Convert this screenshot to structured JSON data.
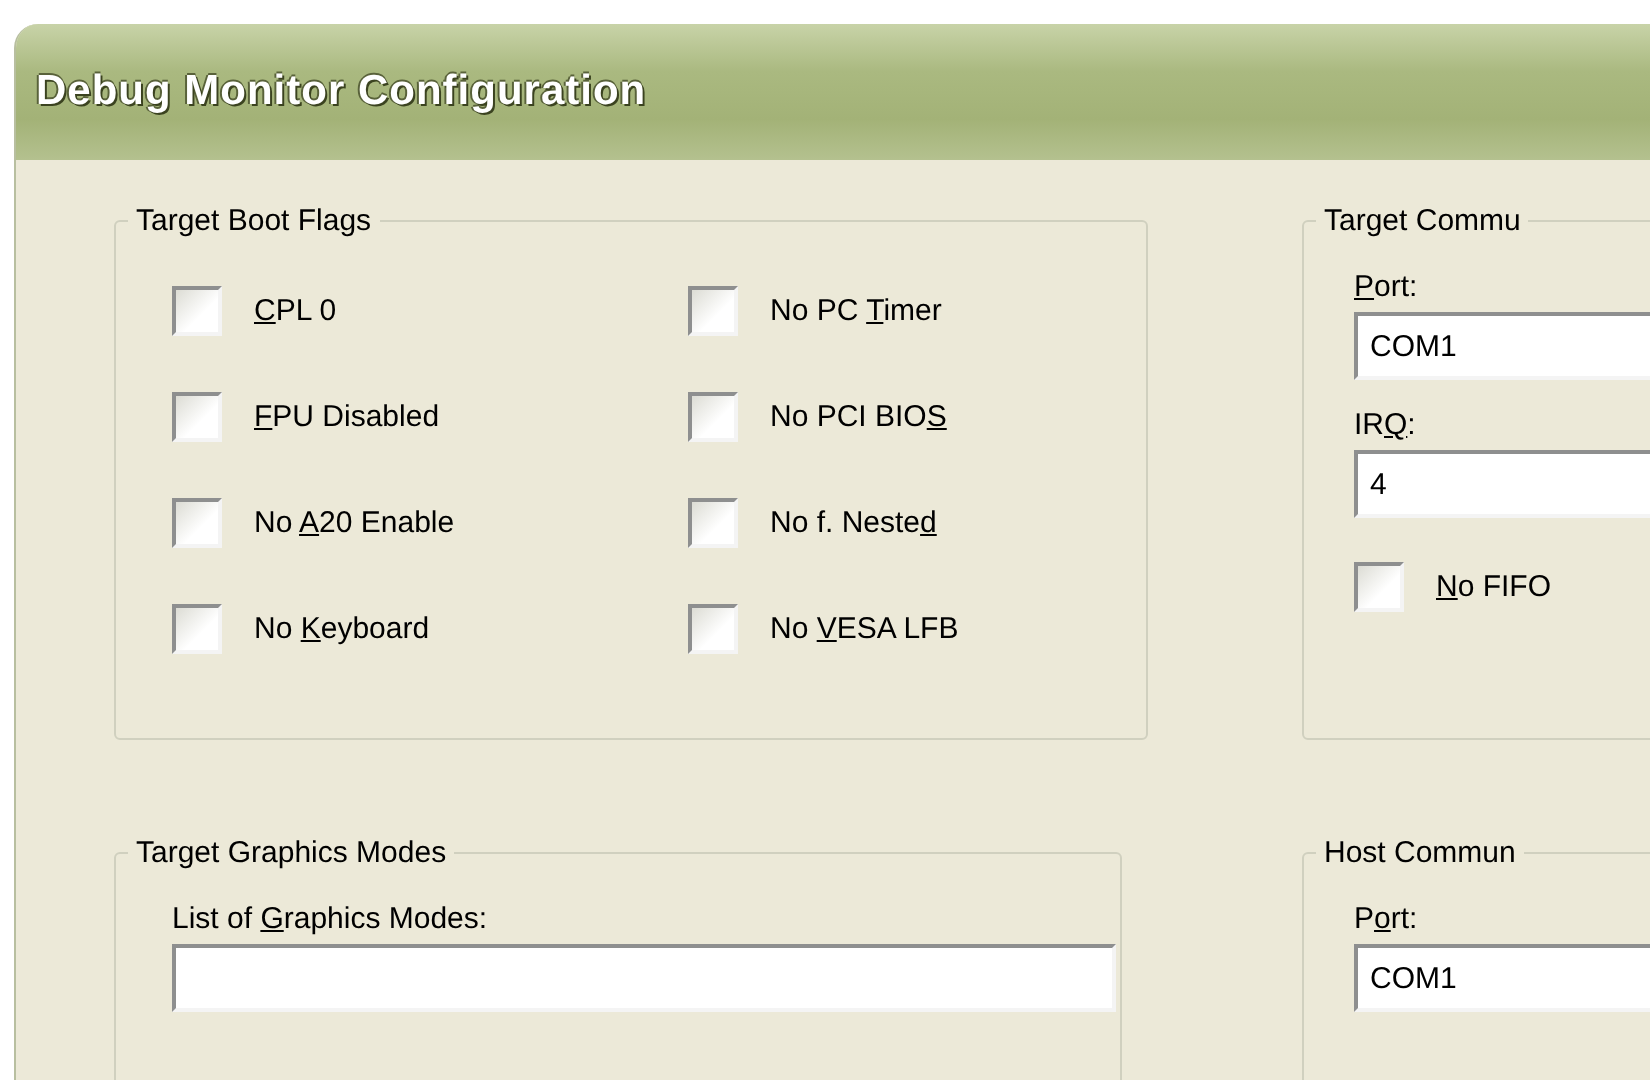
{
  "window": {
    "title": "Debug Monitor Configuration"
  },
  "boot_flags": {
    "title": "Target Boot Flags",
    "options": [
      {
        "label": [
          {
            "text": "C",
            "underlined": true
          },
          {
            "text": "PL 0",
            "underlined": false
          }
        ],
        "checked": false
      },
      {
        "label": [
          {
            "text": "No PC ",
            "underlined": false
          },
          {
            "text": "T",
            "underlined": true
          },
          {
            "text": "imer",
            "underlined": false
          }
        ],
        "checked": false
      },
      {
        "label": [
          {
            "text": "F",
            "underlined": true
          },
          {
            "text": "PU Disabled",
            "underlined": false
          }
        ],
        "checked": false
      },
      {
        "label": [
          {
            "text": "No PCI BIO",
            "underlined": false
          },
          {
            "text": "S",
            "underlined": true
          }
        ],
        "checked": false
      },
      {
        "label": [
          {
            "text": "No ",
            "underlined": false
          },
          {
            "text": "A",
            "underlined": true
          },
          {
            "text": "20 Enable",
            "underlined": false
          }
        ],
        "checked": false
      },
      {
        "label": [
          {
            "text": "No f. Neste",
            "underlined": false
          },
          {
            "text": "d",
            "underlined": true
          }
        ],
        "checked": false
      },
      {
        "label": [
          {
            "text": "No ",
            "underlined": false
          },
          {
            "text": "K",
            "underlined": true
          },
          {
            "text": "eyboard",
            "underlined": false
          }
        ],
        "checked": false
      },
      {
        "label": [
          {
            "text": "No ",
            "underlined": false
          },
          {
            "text": "V",
            "underlined": true
          },
          {
            "text": "ESA LFB",
            "underlined": false
          }
        ],
        "checked": false
      }
    ]
  },
  "target_comm": {
    "title": "Target Commu",
    "port": {
      "label": [
        {
          "text": "P",
          "underlined": true
        },
        {
          "text": "ort:",
          "underlined": false
        }
      ],
      "value": "COM1"
    },
    "irq": {
      "label": [
        {
          "text": "IR",
          "underlined": false
        },
        {
          "text": "Q",
          "underlined": true
        },
        {
          "text": ":",
          "underlined": false
        }
      ],
      "value": "4"
    },
    "no_fifo": {
      "label": [
        {
          "text": "N",
          "underlined": true
        },
        {
          "text": "o FIFO",
          "underlined": false
        }
      ],
      "checked": false
    }
  },
  "graphics_modes": {
    "title": "Target Graphics Modes",
    "list": {
      "label": [
        {
          "text": "List of ",
          "underlined": false
        },
        {
          "text": "G",
          "underlined": true
        },
        {
          "text": "raphics Modes:",
          "underlined": false
        }
      ]
    }
  },
  "host_comm": {
    "title": "Host Commun",
    "port": {
      "label": [
        {
          "text": "P",
          "underlined": false
        },
        {
          "text": "o",
          "underlined": true
        },
        {
          "text": "rt:",
          "underlined": false
        }
      ],
      "value": "COM1"
    }
  }
}
